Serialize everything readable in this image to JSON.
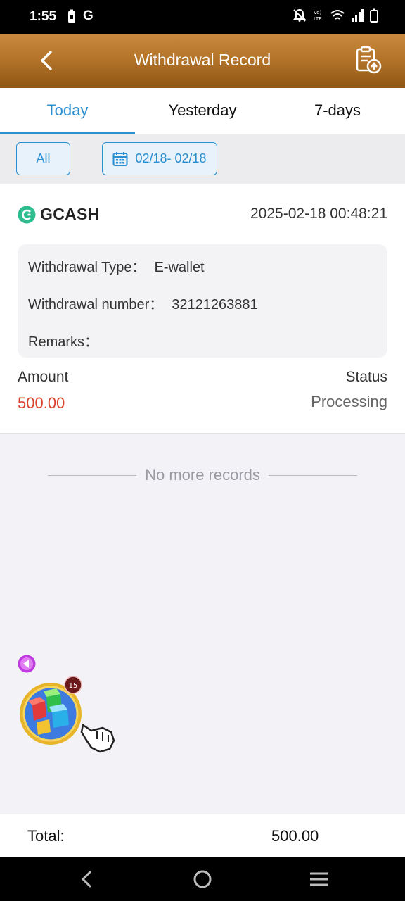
{
  "status_bar": {
    "time": "1:55",
    "left_icons": [
      "battery-saver-icon",
      "google-g-icon"
    ],
    "g_label": "G",
    "right_icons": [
      "mute-bell-icon",
      "volte-lte-icon",
      "wifi-icon",
      "signal-icon",
      "battery-icon"
    ]
  },
  "header": {
    "title": "Withdrawal Record",
    "back_icon": "chevron-left-icon",
    "action_icon": "clipboard-upload-icon"
  },
  "tabs": [
    {
      "label": "Today",
      "active": true
    },
    {
      "label": "Yesterday",
      "active": false
    },
    {
      "label": "7-days",
      "active": false
    }
  ],
  "filters": {
    "all_label": "All",
    "date_range": "02/18- 02/18",
    "date_icon": "calendar-icon"
  },
  "record": {
    "provider": "GCASH",
    "datetime": "2025-02-18 00:48:21",
    "type_label": "Withdrawal Type：",
    "type_value": "E-wallet",
    "number_label": "Withdrawal number：",
    "number_value": "32121263881",
    "remarks_label": "Remarks：",
    "remarks_value": "",
    "amount_label": "Amount",
    "amount_value": "500.00",
    "status_label": "Status",
    "status_value": "Processing"
  },
  "no_more": "No more records",
  "floating": {
    "badge_count": "15"
  },
  "total": {
    "label": "Total:",
    "value": "500.00"
  },
  "colors": {
    "accent": "#2a8fd0",
    "header_gold": "#b5752a",
    "amount_red": "#d9412b"
  }
}
